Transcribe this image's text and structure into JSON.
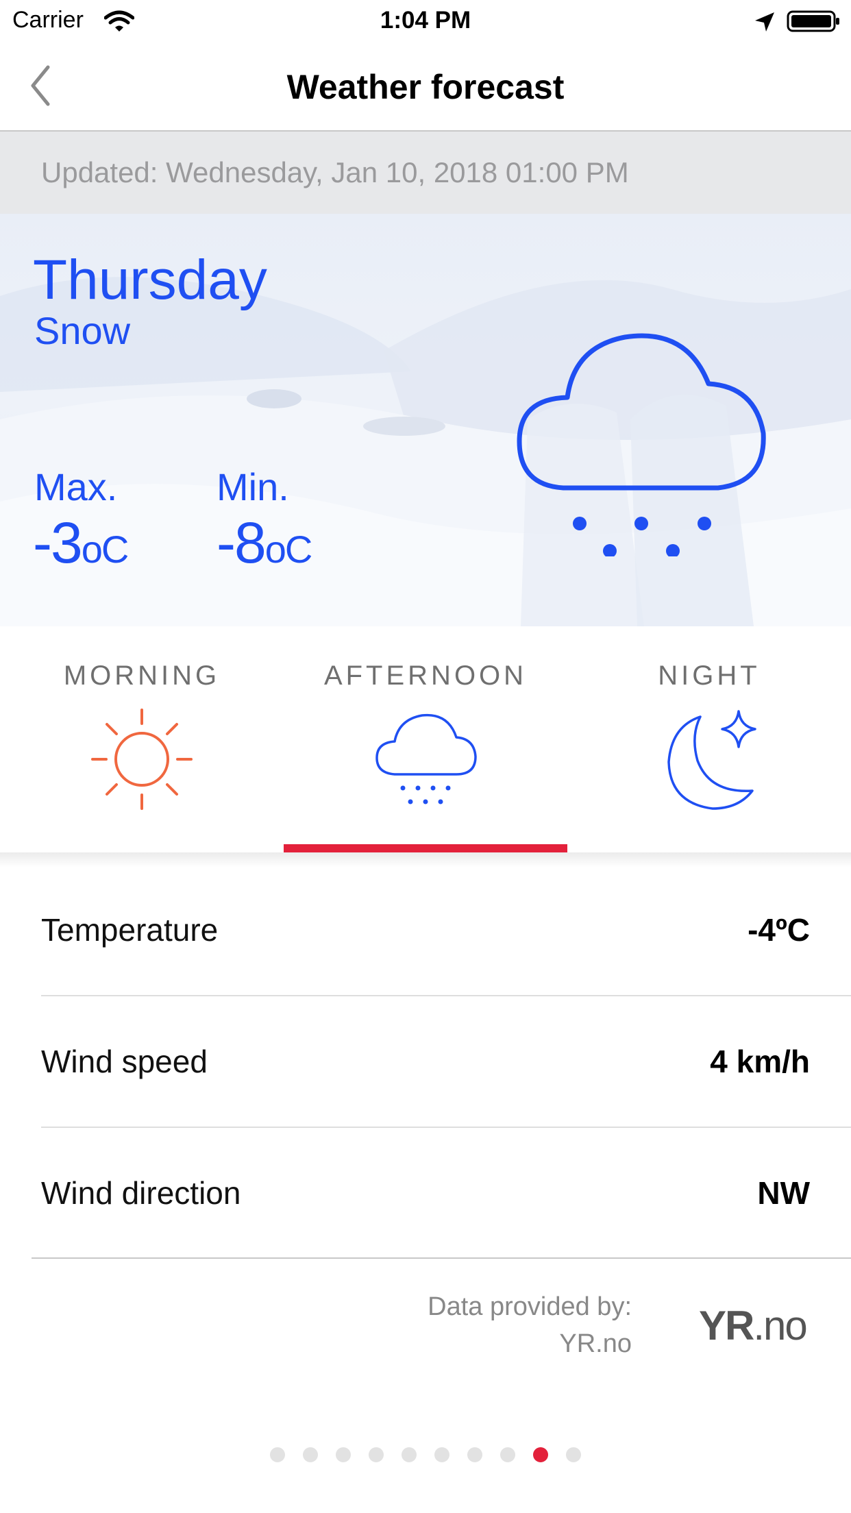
{
  "status_bar": {
    "carrier": "Carrier",
    "time": "1:04 PM"
  },
  "nav": {
    "title": "Weather forecast"
  },
  "updated": {
    "text": "Updated: Wednesday, Jan 10, 2018 01:00 PM"
  },
  "hero": {
    "day": "Thursday",
    "condition": "Snow",
    "max_label": "Max.",
    "max_value": "-3",
    "max_unit": "oC",
    "min_label": "Min.",
    "min_value": "-8",
    "min_unit": "oC",
    "icon": "snow-cloud-icon"
  },
  "tabs": [
    {
      "label": "MORNING",
      "icon": "sun-icon",
      "color": "#f0673f"
    },
    {
      "label": "AFTERNOON",
      "icon": "snow-cloud-icon",
      "color": "#1f4ff2",
      "selected": true
    },
    {
      "label": "NIGHT",
      "icon": "moon-star-icon",
      "color": "#1f4ff2"
    }
  ],
  "details": [
    {
      "label": "Temperature",
      "value": "-4ºC"
    },
    {
      "label": "Wind speed",
      "value": "4 km/h"
    },
    {
      "label": "Wind direction",
      "value": "NW"
    }
  ],
  "provider": {
    "line1": "Data provided by:",
    "line2": "YR.no",
    "logo_bold": "YR",
    "logo_light": ".no"
  },
  "pagination": {
    "total": 10,
    "current": 9
  },
  "colors": {
    "accent_blue": "#1f4ff2",
    "accent_red": "#e3213b",
    "sun_orange": "#f0673f"
  }
}
